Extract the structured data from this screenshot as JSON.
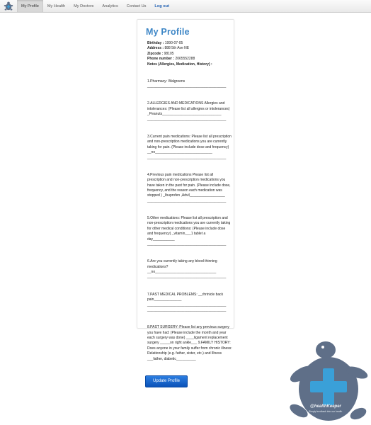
{
  "nav": {
    "items": [
      {
        "label": "My Profile",
        "active": true
      },
      {
        "label": "My Health"
      },
      {
        "label": "My Doctors"
      },
      {
        "label": "Analytics"
      },
      {
        "label": "Contact Us"
      }
    ],
    "logout": "Log out"
  },
  "profile": {
    "title": "My Profile",
    "birthday_label": "Birthday :",
    "birthday": "1990-07-05",
    "address_label": "Address :",
    "address": "888 5th Ave NE",
    "zipcode_label": "Zipcode :",
    "zipcode": "98105",
    "phone_label": "Phone number :",
    "phone": "2065552288",
    "notes_label": "Notes (Allergies, Medication, History) :",
    "notes": [
      "1.Pharmacy: Walgreens\n________________________________________",
      "2.ALLERGIES AND MEDICATIONS Allergies and intolerances: (Please list all allergies or intolerances) _Peanuts______________________________\n________________________________________",
      "3.Current pain medications: Please list all prescription and non-prescription medications you are currently taking for pain. (Please include dose and frequency) __no_____________________________\n________________________________________",
      "4.Previous pain medications Please list all prescription and non-prescription medications you have taken in the past for pain. (Please include dose, frequency, and the reason each medication was stopped ) _Ibuprofen ,Advil__________________\n________________________________________",
      "5.Other medications: Please list all prescription and non-prescription medications you are currently taking for other medical conditions: (Please include dose and frequency) _vitamin___1 tablet a day___________\n________________________________________",
      "6.Are you currently taking any blood thinning medications? __no_______________________________\n________________________________________",
      "7.PAST MEDICAL PROBLEMS: __rhrinicle back pain______________\n________________________________________\n________________________________________",
      "8.PAST SURGERY: Please list any previous surgery you have had: (Please include the month and year each surgery was done) ____ligament replacement surgery _____on right ankle___ 9.FAMILY HISTORY: Does anyone in your family suffer from chronic illness: Relationship (e.g. father, sister, etc.) and Illness ___father, diabetic__________"
    ],
    "update_button": "Update Profile"
  },
  "logo": {
    "name": "@healthKeeper",
    "tagline": "Simply feedback into our health"
  },
  "colors": {
    "title": "#3d86c6",
    "button": "#0b52b8",
    "logo_turtle": "#5f6f88",
    "logo_cross": "#3aa0d8"
  }
}
